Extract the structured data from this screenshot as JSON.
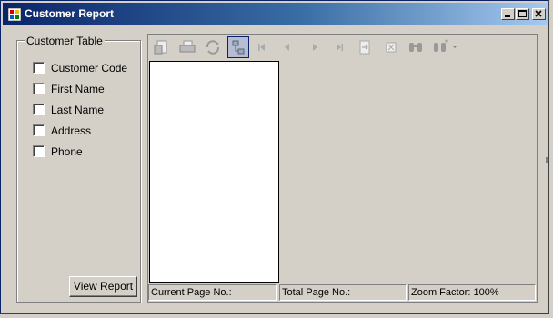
{
  "window": {
    "title": "Customer Report"
  },
  "group": {
    "label": "Customer Table",
    "fields": [
      {
        "label": "Customer Code",
        "checked": false
      },
      {
        "label": "First Name",
        "checked": false
      },
      {
        "label": "Last Name",
        "checked": false
      },
      {
        "label": "Address",
        "checked": false
      },
      {
        "label": "Phone",
        "checked": false
      }
    ]
  },
  "buttons": {
    "view_report": "View Report"
  },
  "toolbar": {
    "tools": [
      "export-icon",
      "print-icon",
      "refresh-icon",
      "group-tree-icon",
      "first-page-icon",
      "previous-page-icon",
      "next-page-icon",
      "last-page-icon",
      "goto-page-icon",
      "close-view-icon",
      "search-icon",
      "zoom-icon"
    ],
    "active_tool": "group-tree-icon"
  },
  "statusbar": {
    "current_page": "Current Page No.:",
    "total_page": "Total Page No.:",
    "zoom": "Zoom Factor: 100%"
  },
  "colors": {
    "titlebar_start": "#0a246a",
    "titlebar_end": "#a6caf0",
    "face": "#d4d0c8"
  }
}
